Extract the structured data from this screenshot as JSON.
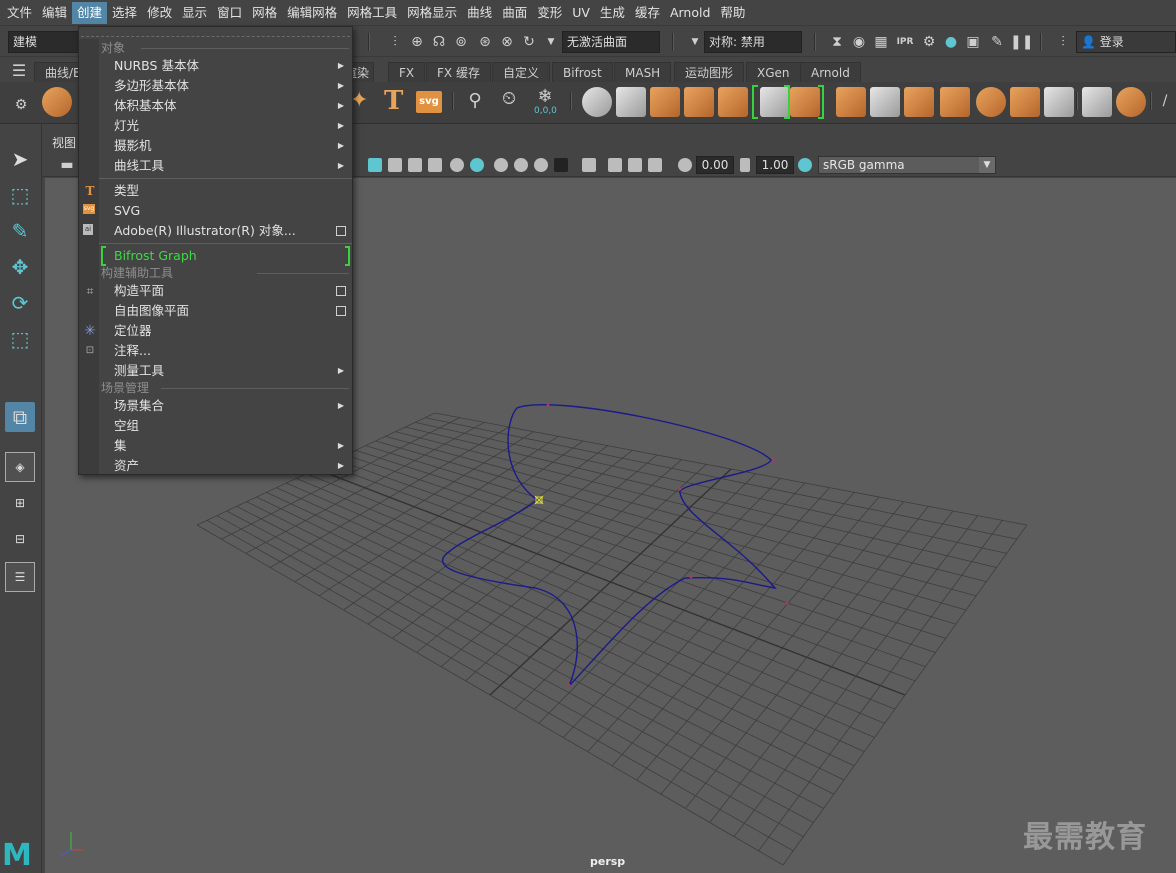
{
  "menubar": {
    "items": [
      "文件",
      "编辑",
      "创建",
      "选择",
      "修改",
      "显示",
      "窗口",
      "网格",
      "编辑网格",
      "网格工具",
      "网格显示",
      "曲线",
      "曲面",
      "变形",
      "UV",
      "生成",
      "缓存",
      "Arnold",
      "帮助"
    ],
    "active_index": 2
  },
  "statusline": {
    "mode": "建模",
    "live_surface": "无激活曲面",
    "symmetry": "对称: 禁用",
    "login": "登录"
  },
  "shelf": {
    "tabs": [
      "曲线/曲面",
      "渲染",
      "FX",
      "FX 缓存",
      "自定义",
      "Bifrost",
      "MASH",
      "运动图形",
      "XGen",
      "Arnold"
    ],
    "tab_visible_text": [
      "曲线/E",
      "渲染",
      "FX",
      "FX 缓存",
      "自定义",
      "Bifrost",
      "MASH",
      "运动图形",
      "XGen",
      "Arnold"
    ],
    "text_tool": "T",
    "svg_tool": "svg",
    "coord_label": "0,0,0"
  },
  "panel": {
    "menu_label": "视图",
    "exposure": "0.00",
    "gamma": "1.00",
    "colorspace": "sRGB gamma",
    "camera": "persp"
  },
  "watermark": "最需教育",
  "create_menu": {
    "sections": [
      {
        "title": "对象",
        "items": [
          {
            "label": "NURBS 基本体",
            "submenu": true,
            "icon": ""
          },
          {
            "label": "多边形基本体",
            "submenu": true,
            "icon": ""
          },
          {
            "label": "体积基本体",
            "submenu": true,
            "icon": ""
          },
          {
            "label": "灯光",
            "submenu": true,
            "icon": ""
          },
          {
            "label": "摄影机",
            "submenu": true,
            "icon": ""
          },
          {
            "label": "曲线工具",
            "submenu": true,
            "icon": ""
          }
        ]
      },
      {
        "title": "",
        "items": [
          {
            "label": "类型",
            "icon": "type-T-icon"
          },
          {
            "label": "SVG",
            "icon": "svg-icon"
          },
          {
            "label": "Adobe(R) Illustrator(R) 对象...",
            "option_box": true,
            "icon": "illustrator-icon"
          }
        ]
      },
      {
        "title": "",
        "items": [
          {
            "label": "Bifrost Graph",
            "highlight": "green"
          }
        ]
      },
      {
        "title": "构建辅助工具",
        "items": [
          {
            "label": "构造平面",
            "option_box": true,
            "icon": "construction-plane-icon"
          },
          {
            "label": "自由图像平面",
            "option_box": true,
            "icon": ""
          },
          {
            "label": "定位器",
            "icon": "locator-icon"
          },
          {
            "label": "注释...",
            "icon": "annotation-icon"
          },
          {
            "label": "测量工具",
            "submenu": true,
            "icon": ""
          }
        ]
      },
      {
        "title": "场景管理",
        "items": [
          {
            "label": "场景集合",
            "submenu": true
          },
          {
            "label": "空组"
          },
          {
            "label": "集",
            "submenu": true
          },
          {
            "label": "资产",
            "submenu": true
          }
        ]
      }
    ]
  },
  "colors": {
    "accent": "#5285a6",
    "curve": "#1a1a8c",
    "bifrost_green": "#36d33e",
    "shelf_orange": "#e09240"
  }
}
